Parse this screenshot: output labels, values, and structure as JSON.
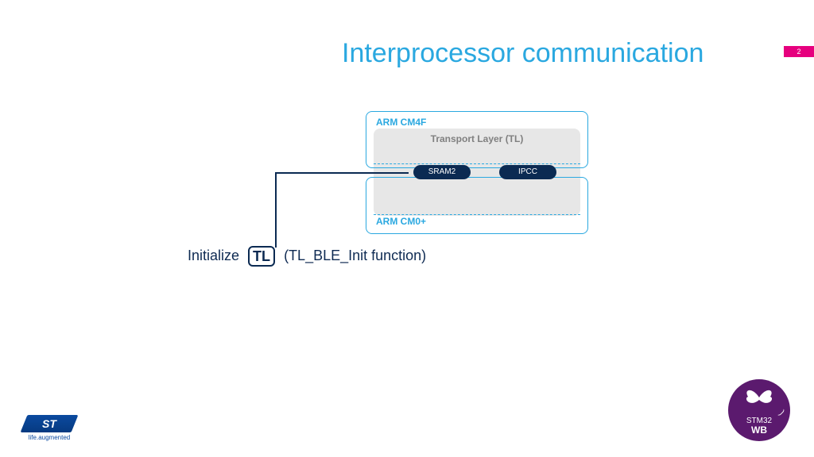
{
  "page": {
    "number": "2"
  },
  "title": "Interprocessor communication",
  "diagram": {
    "cpu_top": "ARM CM4F",
    "cpu_bottom": "ARM CM0+",
    "tl_label": "Transport Layer (TL)",
    "sram_label": "SRAM2",
    "ipcc_label": "IPCC"
  },
  "caption": {
    "prefix": "Initialize",
    "box": "TL",
    "suffix": "(TL_BLE_Init function)"
  },
  "logo": {
    "st_text": "ST",
    "st_tag": "life.augmented",
    "stm32": "STM",
    "thirtytwo": "32",
    "wb": "WB"
  }
}
